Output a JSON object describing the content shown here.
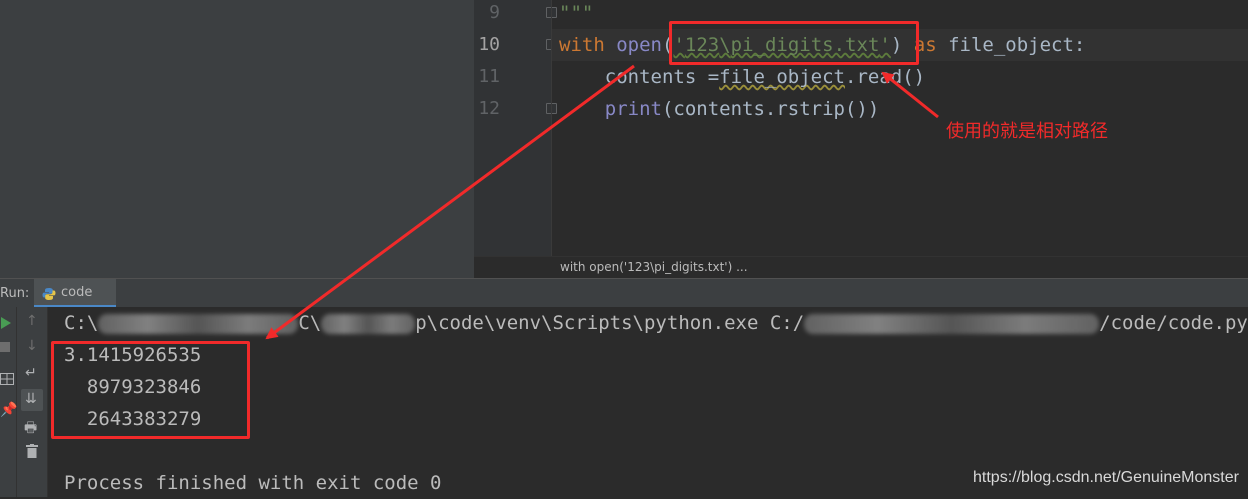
{
  "editor": {
    "line_numbers": [
      "9",
      "10",
      "11",
      "12"
    ],
    "line9": {
      "text": "\"\"\""
    },
    "line10": {
      "kw_with": "with",
      "fn_open": "open",
      "paren_open": "(",
      "str_q1": "'",
      "str_p1": "123",
      "str_sep": "\\",
      "str_p2": "pi_digits.txt",
      "str_q2": "'",
      "paren_close": ")",
      "kw_as": "as",
      "rest": " file_object:"
    },
    "line11": {
      "indent": "    ",
      "p1": "contents =",
      "p2": "file_object",
      "p3": ".read()"
    },
    "line12": {
      "indent": "    ",
      "fn_print": "print",
      "p1": "(contents.rstrip())"
    },
    "breadcrumb": "with open('123\\pi_digits.txt') ..."
  },
  "run": {
    "label": "Run:",
    "tab_label": "code",
    "console": {
      "cmd_a": "C:\\",
      "cmd_b": "C\\",
      "cmd_c": "p\\code\\venv\\Scripts\\python.exe C:/",
      "cmd_d": "/code/code.py",
      "out1": "3.1415926535",
      "out2": "  8979323846",
      "out3": "  2643383279",
      "finish": "Process finished with exit code 0"
    }
  },
  "annotation": "使用的就是相对路径",
  "watermark": "https://blog.csdn.net/GenuineMonster",
  "colors": {
    "keyword": "#cc7832",
    "builtin": "#8888c6",
    "string": "#6a8759",
    "text": "#a9b7c6",
    "annotation": "#f12a2a"
  },
  "icons": [
    "python-file-icon",
    "run-icon",
    "stop-icon",
    "layout-icon",
    "pin-icon",
    "scroll-up-icon",
    "scroll-down-icon",
    "soft-wrap-icon",
    "scroll-to-end-icon",
    "print-icon",
    "trash-icon"
  ]
}
